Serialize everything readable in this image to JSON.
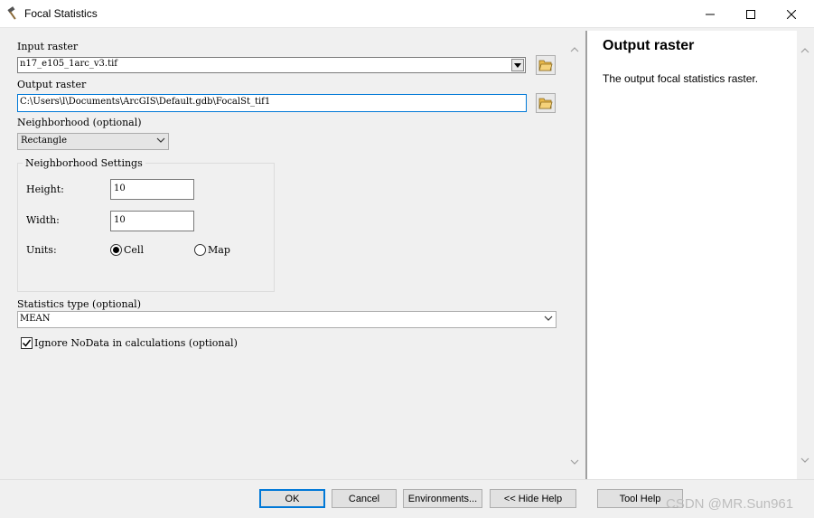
{
  "window": {
    "title": "Focal Statistics",
    "icon": "hammer-icon"
  },
  "form": {
    "input_raster": {
      "label": "Input raster",
      "value": "n17_e105_1arc_v3.tif"
    },
    "output_raster": {
      "label": "Output raster",
      "value": "C:\\Users\\l\\Documents\\ArcGIS\\Default.gdb\\FocalSt_tif1"
    },
    "neighborhood": {
      "label": "Neighborhood (optional)",
      "value": "Rectangle"
    },
    "neighborhood_settings": {
      "legend": "Neighborhood Settings",
      "height_label": "Height:",
      "height_value": "10",
      "width_label": "Width:",
      "width_value": "10",
      "units_label": "Units:",
      "unit_cell": "Cell",
      "unit_map": "Map",
      "selected_unit": "Cell"
    },
    "statistics_type": {
      "label": "Statistics type (optional)",
      "value": "MEAN"
    },
    "ignore_nodata": {
      "label": "Ignore NoData in calculations (optional)",
      "checked": true
    }
  },
  "help": {
    "title": "Output raster",
    "body": "The output focal statistics raster."
  },
  "buttons": {
    "ok": "OK",
    "cancel": "Cancel",
    "environments": "Environments...",
    "hide_help": "<< Hide Help",
    "tool_help": "Tool Help"
  },
  "watermark": "CSDN @MR.Sun961",
  "colors": {
    "focus": "#0078d7",
    "panel": "#f0f0f0"
  }
}
